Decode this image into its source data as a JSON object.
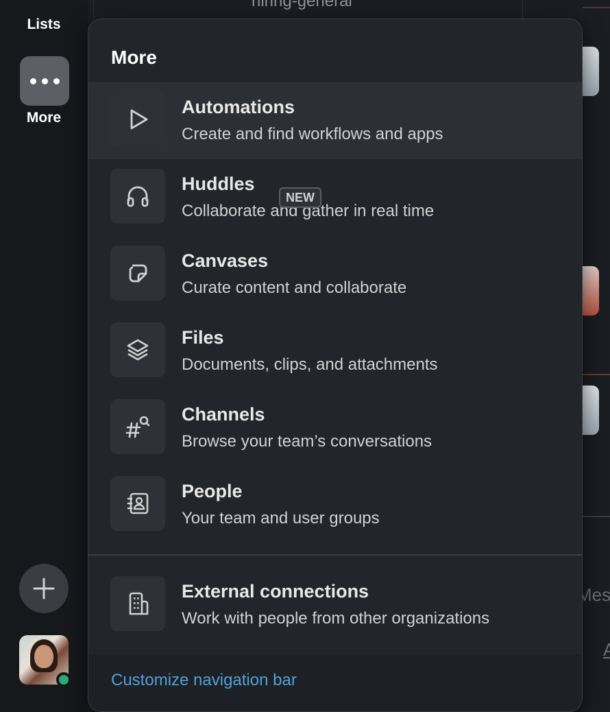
{
  "rail": {
    "lists_label": "Lists",
    "more_label": "More"
  },
  "background": {
    "channel_name": "hiring-general",
    "partial_text_1": "Mess",
    "partial_text_2": "A"
  },
  "menu": {
    "title": "More",
    "items": [
      {
        "title": "Automations",
        "subtitle": "Create and find workflows and apps",
        "icon": "play-icon"
      },
      {
        "title": "Huddles",
        "subtitle": "Collaborate and gather in real time",
        "icon": "headphones-icon"
      },
      {
        "title": "Canvases",
        "subtitle": "Curate content and collaborate",
        "icon": "canvas-icon",
        "badge": "NEW"
      },
      {
        "title": "Files",
        "subtitle": "Documents, clips, and attachments",
        "icon": "layers-icon"
      },
      {
        "title": "Channels",
        "subtitle": "Browse your team’s conversations",
        "icon": "channel-search-icon"
      },
      {
        "title": "People",
        "subtitle": "Your team and user groups",
        "icon": "contacts-icon"
      }
    ],
    "external": {
      "title": "External connections",
      "subtitle": "Work with people from other organizations",
      "icon": "building-icon"
    },
    "footer_link": "Customize navigation bar"
  },
  "colors": {
    "menu_bg": "#222529",
    "hover_bg": "#2c2f33",
    "link": "#4fa3d8",
    "presence": "#2bac76"
  }
}
